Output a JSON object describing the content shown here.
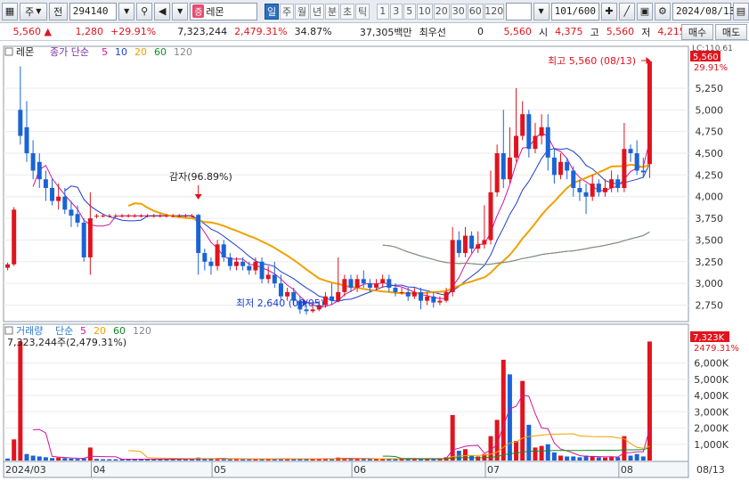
{
  "toolbar": {
    "chart_type_label": "주",
    "market_label": "전",
    "code": "294140",
    "sound_icon": "speaker-icon",
    "badge": "증",
    "name": "레몬",
    "periods": [
      "일",
      "주",
      "월",
      "년",
      "분",
      "초",
      "틱"
    ],
    "active_period": "일",
    "minute_options": [
      "1",
      "3",
      "5",
      "10",
      "20",
      "30",
      "60",
      "120"
    ],
    "page_counter": "101/600",
    "date": "2024/08/13"
  },
  "quote": {
    "price": "5,560",
    "arrow": "▲",
    "change": "1,280",
    "change_pct": "+29.91%",
    "volume": "7,323,244",
    "volume_ratio": "2,479.31%",
    "turnover": "34.87%",
    "value": "37,305백만",
    "pref_label": "최우선",
    "pref_value": "0",
    "ask": "5,560",
    "open_label": "시",
    "open": "4,375",
    "high_label": "고",
    "high": "5,560",
    "low_label": "저",
    "low": "4,215",
    "buy_label": "매수",
    "sell_label": "매도"
  },
  "price_panel": {
    "title": "레몬",
    "ma_label": "종가 단순",
    "ma_periods": [
      "5",
      "10",
      "20",
      "60",
      "120"
    ],
    "ma_colors": [
      "#d4149a",
      "#1f3fcf",
      "#f0a000",
      "#138a22",
      "#888888"
    ],
    "current_price_tag": "5,560",
    "current_pct_tag": "29.91%",
    "lc_label": "LC:110.61",
    "high_annotation": "최고 5,560 (08/13)",
    "low_annotation": "최저 2,640 (06/05)",
    "event_annotation": "감자(96.89%)",
    "y_ticks": [
      "5,250",
      "5,000",
      "4,750",
      "4,500",
      "4,250",
      "4,000",
      "3,750",
      "3,500",
      "3,250",
      "3,000",
      "2,750"
    ]
  },
  "volume_panel": {
    "title": "거래량",
    "ma_label": "단순",
    "ma_periods": [
      "5",
      "20",
      "60",
      "120"
    ],
    "current_volume_text": "7,323,244주(2,479.31%)",
    "current_tag": "7,323K",
    "pct_tag": "2479.31%",
    "y_ticks": [
      "6,000K",
      "5,000K",
      "4,000K",
      "3,000K",
      "2,000K",
      "1,000K"
    ]
  },
  "x_axis": {
    "labels": [
      "2024/03",
      "04",
      "05",
      "06",
      "07",
      "08"
    ],
    "right_label": "08/13"
  },
  "colors": {
    "up": "#e0141e",
    "down": "#1a63d6"
  },
  "chart_data": {
    "type": "candlestick",
    "series": [
      {
        "name": "price",
        "candles": [
          [
            3180,
            3220,
            3150,
            3240
          ],
          [
            3220,
            3850,
            3200,
            3880
          ],
          [
            5000,
            4700,
            4600,
            5500
          ],
          [
            4800,
            4500,
            4400,
            5100
          ],
          [
            4500,
            4300,
            4200,
            4650
          ],
          [
            4400,
            4200,
            4100,
            4500
          ],
          [
            4200,
            4100,
            3950,
            4300
          ],
          [
            4100,
            3950,
            3900,
            4200
          ],
          [
            3950,
            4000,
            3850,
            4150
          ],
          [
            4000,
            3850,
            3800,
            4100
          ],
          [
            3850,
            3780,
            3650,
            3950
          ],
          [
            3800,
            3700,
            3650,
            3900
          ],
          [
            3700,
            3300,
            3250,
            3750
          ],
          [
            3300,
            3750,
            3100,
            4050
          ],
          [
            3780,
            3780,
            3750,
            3800
          ],
          [
            3780,
            3780,
            3760,
            3800
          ],
          [
            3780,
            3780,
            3760,
            3800
          ],
          [
            3780,
            3780,
            3760,
            3800
          ],
          [
            3780,
            3780,
            3760,
            3800
          ],
          [
            3780,
            3780,
            3760,
            3800
          ],
          [
            3780,
            3780,
            3760,
            3800
          ],
          [
            3780,
            3780,
            3760,
            3800
          ],
          [
            3780,
            3780,
            3760,
            3800
          ],
          [
            3780,
            3780,
            3760,
            3800
          ],
          [
            3780,
            3780,
            3760,
            3800
          ],
          [
            3780,
            3780,
            3760,
            3800
          ],
          [
            3780,
            3780,
            3760,
            3800
          ],
          [
            3780,
            3780,
            3760,
            3800
          ],
          [
            3780,
            3780,
            3760,
            3800
          ],
          [
            3780,
            3780,
            3760,
            3800
          ],
          [
            3790,
            3350,
            3100,
            3800
          ],
          [
            3350,
            3250,
            3150,
            3400
          ],
          [
            3250,
            3200,
            3100,
            3300
          ],
          [
            3200,
            3450,
            3150,
            3500
          ],
          [
            3450,
            3300,
            3250,
            3500
          ],
          [
            3300,
            3200,
            3150,
            3350
          ],
          [
            3200,
            3250,
            3150,
            3300
          ],
          [
            3250,
            3200,
            3150,
            3300
          ],
          [
            3200,
            3150,
            3100,
            3250
          ],
          [
            3150,
            3250,
            3100,
            3300
          ],
          [
            3250,
            3050,
            3000,
            3300
          ],
          [
            3050,
            3100,
            3000,
            3200
          ],
          [
            3100,
            3000,
            2950,
            3250
          ],
          [
            3000,
            2850,
            2800,
            3100
          ],
          [
            2850,
            2900,
            2800,
            2950
          ],
          [
            2900,
            2800,
            2750,
            2950
          ],
          [
            2800,
            2700,
            2650,
            2850
          ],
          [
            2700,
            2680,
            2640,
            2750
          ],
          [
            2680,
            2700,
            2660,
            2750
          ],
          [
            2700,
            2750,
            2680,
            2800
          ],
          [
            2750,
            2850,
            2720,
            2900
          ],
          [
            2850,
            2800,
            2750,
            3000
          ],
          [
            2800,
            2900,
            2780,
            3300
          ],
          [
            2900,
            3050,
            2850,
            3100
          ],
          [
            3050,
            2950,
            2900,
            3100
          ],
          [
            2950,
            3050,
            2900,
            3100
          ],
          [
            3050,
            3000,
            2950,
            3150
          ],
          [
            3000,
            2950,
            2900,
            3050
          ],
          [
            2950,
            3000,
            2920,
            3050
          ],
          [
            3000,
            3050,
            2950,
            3100
          ],
          [
            3050,
            2950,
            2900,
            3100
          ],
          [
            2950,
            2900,
            2850,
            3000
          ],
          [
            2900,
            2900,
            2870,
            2950
          ],
          [
            2900,
            2850,
            2800,
            2950
          ],
          [
            2850,
            2900,
            2820,
            2950
          ],
          [
            2900,
            2800,
            2700,
            2950
          ],
          [
            2800,
            2850,
            2750,
            2900
          ],
          [
            2850,
            2780,
            2720,
            2900
          ],
          [
            2780,
            2800,
            2750,
            2850
          ],
          [
            2800,
            2900,
            2780,
            2950
          ],
          [
            2900,
            3500,
            2850,
            3650
          ],
          [
            3500,
            3350,
            3300,
            3600
          ],
          [
            3350,
            3550,
            3300,
            3650
          ],
          [
            3550,
            3400,
            3350,
            3600
          ],
          [
            3400,
            3450,
            3350,
            3600
          ],
          [
            3450,
            3500,
            3400,
            3900
          ],
          [
            3500,
            4050,
            3450,
            4300
          ],
          [
            4050,
            4500,
            4000,
            4600
          ],
          [
            4500,
            4200,
            4100,
            5000
          ],
          [
            4200,
            4450,
            4150,
            4800
          ],
          [
            4450,
            4700,
            4400,
            5250
          ],
          [
            4700,
            4950,
            4650,
            5100
          ],
          [
            4950,
            4550,
            4450,
            5000
          ],
          [
            4550,
            4700,
            4500,
            4850
          ],
          [
            4700,
            4800,
            4600,
            4950
          ],
          [
            4800,
            4450,
            4300,
            4950
          ],
          [
            4450,
            4250,
            4150,
            4550
          ],
          [
            4250,
            4400,
            4200,
            4500
          ],
          [
            4400,
            4300,
            4200,
            4450
          ],
          [
            4300,
            4100,
            4000,
            4350
          ],
          [
            4100,
            4050,
            3950,
            4200
          ],
          [
            4050,
            4000,
            3800,
            4150
          ],
          [
            4000,
            4150,
            3950,
            4250
          ],
          [
            4150,
            4050,
            4000,
            4200
          ],
          [
            4050,
            4100,
            4000,
            4200
          ],
          [
            4100,
            4200,
            4050,
            4300
          ],
          [
            4200,
            4100,
            4050,
            4250
          ],
          [
            4100,
            4550,
            4050,
            4850
          ],
          [
            4550,
            4500,
            4400,
            4600
          ],
          [
            4500,
            4300,
            4250,
            4650
          ],
          [
            4300,
            4280,
            4215,
            4450
          ],
          [
            4375,
            5560,
            4215,
            5560
          ]
        ]
      }
    ],
    "volumes": [
      [
        120,
        0
      ],
      [
        1300,
        1
      ],
      [
        7323,
        1
      ],
      [
        400,
        0
      ],
      [
        300,
        0
      ],
      [
        250,
        0
      ],
      [
        200,
        0
      ],
      [
        150,
        0
      ],
      [
        180,
        1
      ],
      [
        150,
        0
      ],
      [
        120,
        0
      ],
      [
        100,
        0
      ],
      [
        130,
        0
      ],
      [
        800,
        1
      ],
      [
        100,
        0
      ],
      [
        80,
        0
      ],
      [
        80,
        0
      ],
      [
        80,
        0
      ],
      [
        80,
        0
      ],
      [
        80,
        0
      ],
      [
        80,
        0
      ],
      [
        80,
        0
      ],
      [
        80,
        0
      ],
      [
        80,
        0
      ],
      [
        80,
        0
      ],
      [
        80,
        0
      ],
      [
        80,
        0
      ],
      [
        80,
        0
      ],
      [
        80,
        0
      ],
      [
        80,
        0
      ],
      [
        180,
        0
      ],
      [
        120,
        0
      ],
      [
        100,
        0
      ],
      [
        140,
        1
      ],
      [
        110,
        0
      ],
      [
        90,
        0
      ],
      [
        100,
        1
      ],
      [
        90,
        0
      ],
      [
        80,
        0
      ],
      [
        90,
        1
      ],
      [
        110,
        0
      ],
      [
        90,
        1
      ],
      [
        100,
        0
      ],
      [
        120,
        0
      ],
      [
        90,
        1
      ],
      [
        100,
        0
      ],
      [
        110,
        0
      ],
      [
        90,
        0
      ],
      [
        95,
        1
      ],
      [
        100,
        1
      ],
      [
        140,
        1
      ],
      [
        100,
        0
      ],
      [
        180,
        1
      ],
      [
        150,
        1
      ],
      [
        110,
        0
      ],
      [
        110,
        1
      ],
      [
        120,
        0
      ],
      [
        100,
        0
      ],
      [
        100,
        1
      ],
      [
        110,
        1
      ],
      [
        100,
        0
      ],
      [
        100,
        0
      ],
      [
        90,
        1
      ],
      [
        100,
        0
      ],
      [
        90,
        1
      ],
      [
        120,
        0
      ],
      [
        100,
        1
      ],
      [
        90,
        0
      ],
      [
        90,
        1
      ],
      [
        200,
        1
      ],
      [
        2800,
        1
      ],
      [
        600,
        0
      ],
      [
        700,
        1
      ],
      [
        300,
        0
      ],
      [
        250,
        1
      ],
      [
        400,
        1
      ],
      [
        1500,
        1
      ],
      [
        2500,
        1
      ],
      [
        6200,
        1
      ],
      [
        5300,
        0
      ],
      [
        1200,
        1
      ],
      [
        4900,
        1
      ],
      [
        2200,
        0
      ],
      [
        800,
        1
      ],
      [
        900,
        1
      ],
      [
        1000,
        0
      ],
      [
        500,
        0
      ],
      [
        300,
        1
      ],
      [
        250,
        0
      ],
      [
        250,
        0
      ],
      [
        200,
        0
      ],
      [
        300,
        0
      ],
      [
        250,
        1
      ],
      [
        200,
        0
      ],
      [
        180,
        1
      ],
      [
        250,
        1
      ],
      [
        200,
        0
      ],
      [
        1500,
        1
      ],
      [
        300,
        0
      ],
      [
        400,
        0
      ],
      [
        250,
        0
      ],
      [
        7323,
        1
      ]
    ]
  }
}
